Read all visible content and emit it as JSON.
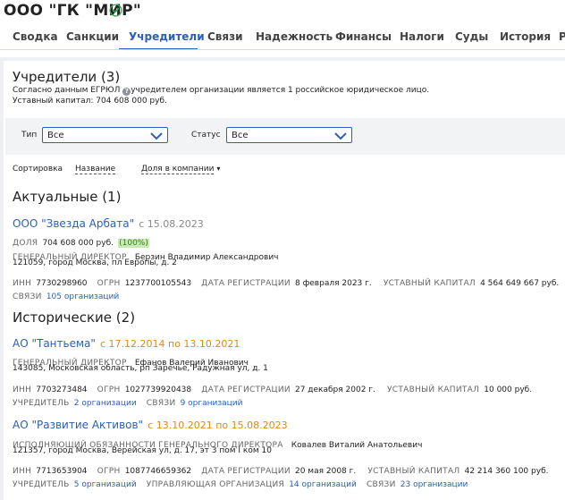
{
  "company": {
    "title": "ООО \"ГК \"МИР\"",
    "verified_icon": "check-circle-icon",
    "verified_color": "#34a853"
  },
  "tabs": [
    {
      "label": "Сводка"
    },
    {
      "label": "Санкции"
    },
    {
      "label": "Учредители",
      "active": true
    },
    {
      "label": "Связи"
    },
    {
      "label": "Надежность"
    },
    {
      "label": "Финансы"
    },
    {
      "label": "Налоги"
    },
    {
      "label": "Суды"
    },
    {
      "label": "История"
    },
    {
      "label": "Р"
    }
  ],
  "founders": {
    "heading": "Учредители (3)",
    "egrul_prefix": "Согласно данным ЕГРЮЛ",
    "egrul_suffix": "учредителем организации является 1 российское юридическое лицо.",
    "capital_line": "Уставный капитал: 704 608 000 руб.",
    "help_icon": "question-circle-icon"
  },
  "filters": {
    "type_label": "Тип",
    "type_value": "Все",
    "status_label": "Статус",
    "status_value": "Все"
  },
  "sort": {
    "label": "Сортировка",
    "by_name": "Название",
    "by_share": "Доля в компании",
    "arrow": "▾"
  },
  "current": {
    "heading": "Актуальные (1)",
    "items": [
      {
        "name": "ООО \"Звезда Арбата\"",
        "date": "с 15.08.2023",
        "share_label": "ДОЛЯ",
        "share_value": "704 608 000 руб.",
        "share_percent": "(100%)",
        "role_label": "ГЕНЕРАЛЬНЫЙ ДИРЕКТОР",
        "role_person": "Берзин Владимир Александрович",
        "address": "121059, город Москва, пл Европы, д. 2",
        "inn_label": "ИНН",
        "inn": "7730298960",
        "ogrn_label": "ОГРН",
        "ogrn": "1237700105543",
        "reg_label": "ДАТА РЕГИСТРАЦИИ",
        "reg": "8 февраля 2023 г.",
        "cap_label": "УСТАВНЫЙ КАПИТАЛ",
        "cap": "4 564 649 667 руб.",
        "links_label": "СВЯЗИ",
        "links": "105 организаций"
      }
    ]
  },
  "historic": {
    "heading": "Исторические (2)",
    "items": [
      {
        "name": "АО \"Тантьема\"",
        "date": "с 17.12.2014 по 13.10.2021",
        "role_label": "ГЕНЕРАЛЬНЫЙ ДИРЕКТОР",
        "role_person": "Ефанов Валерий Иванович",
        "address": "143085, Московская область, рп Заречье, Радужная ул, д. 1",
        "inn_label": "ИНН",
        "inn": "7703273484",
        "ogrn_label": "ОГРН",
        "ogrn": "1027739920438",
        "reg_label": "ДАТА РЕГИСТРАЦИИ",
        "reg": "27 декабря 2002 г.",
        "cap_label": "УСТАВНЫЙ КАПИТАЛ",
        "cap": "10 000 руб.",
        "founder_label": "УЧРЕДИТЕЛЬ",
        "founder": "2 организации",
        "links_label": "СВЯЗИ",
        "links": "9 организаций"
      },
      {
        "name": "АО \"Развитие Активов\"",
        "date": "с 13.10.2021 по 15.08.2023",
        "role_label": "ИСПОЛНЯЮЩИЙ ОБЯЗАННОСТИ ГЕНЕРАЛЬНОГО ДИРЕКТОРА",
        "role_person": "Ковалев Виталий Анатольевич",
        "address": "121357, город Москва, Верейская ул, д. 17, эт 3 пом I ком 10",
        "inn_label": "ИНН",
        "inn": "7713653904",
        "ogrn_label": "ОГРН",
        "ogrn": "1087746659362",
        "reg_label": "ДАТА РЕГИСТРАЦИИ",
        "reg": "20 мая 2008 г.",
        "cap_label": "УСТАВНЫЙ КАПИТАЛ",
        "cap": "42 214 360 100 руб.",
        "founder_label": "УЧРЕДИТЕЛЬ",
        "founder": "5 организаций",
        "mgmt_label": "УПРАВЛЯЮЩАЯ ОРГАНИЗАЦИЯ",
        "mgmt": "14 организаций",
        "links_label": "СВЯЗИ",
        "links": "23 организации"
      }
    ]
  }
}
